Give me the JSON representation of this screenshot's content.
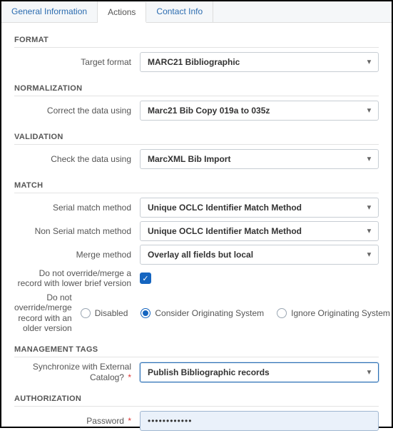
{
  "tabs": {
    "general": "General Information",
    "actions": "Actions",
    "contact": "Contact Info"
  },
  "sections": {
    "format": "FORMAT",
    "normalization": "NORMALIZATION",
    "validation": "VALIDATION",
    "match": "MATCH",
    "management_tags": "MANAGEMENT TAGS",
    "authorization": "AUTHORIZATION"
  },
  "format": {
    "target_format_label": "Target format",
    "target_format_value": "MARC21 Bibliographic"
  },
  "normalization": {
    "correct_label": "Correct the data using",
    "correct_value": "Marc21 Bib Copy 019a to 035z"
  },
  "validation": {
    "check_label": "Check the data using",
    "check_value": "MarcXML Bib Import"
  },
  "match": {
    "serial_label": "Serial match method",
    "serial_value": "Unique OCLC Identifier Match Method",
    "non_serial_label": "Non Serial match method",
    "non_serial_value": "Unique OCLC Identifier Match Method",
    "merge_label": "Merge method",
    "merge_value": "Overlay all fields but local",
    "no_override_brief_label": "Do not override/merge a record with lower brief version",
    "no_override_older_label": "Do not override/merge record with an older version",
    "radio": {
      "disabled": "Disabled",
      "consider": "Consider Originating System",
      "ignore": "Ignore Originating System"
    }
  },
  "management_tags": {
    "sync_label": "Synchronize with External Catalog?",
    "sync_value": "Publish Bibliographic records"
  },
  "authorization": {
    "password_label": "Password",
    "password_value": "••••••••••••"
  }
}
